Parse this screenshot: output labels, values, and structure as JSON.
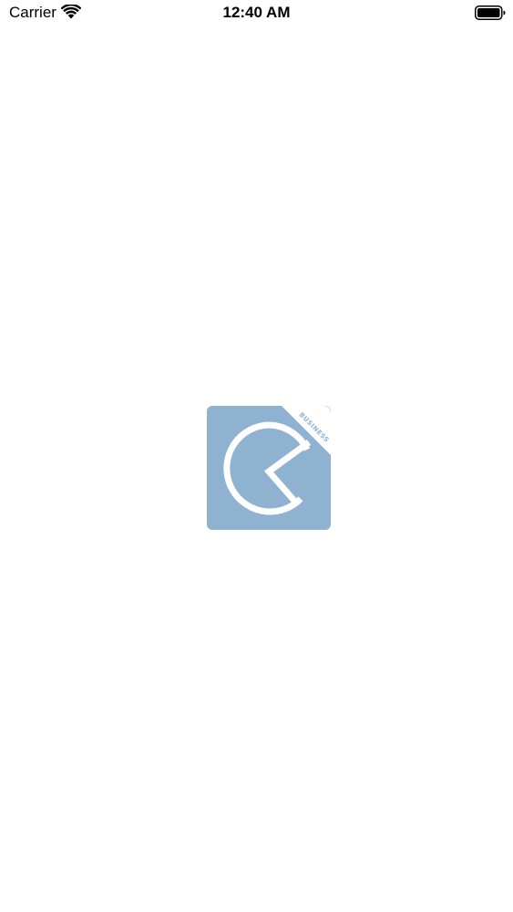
{
  "status_bar": {
    "carrier": "Carrier",
    "time": "12:40 AM",
    "wifi_icon": "wifi-icon",
    "battery_icon": "battery-icon"
  },
  "splash": {
    "logo_icon": "pie-chart-logo-icon",
    "badge_text": "BUSINESS",
    "logo_color": "#8fb2d0",
    "background_color": "#ffffff"
  }
}
